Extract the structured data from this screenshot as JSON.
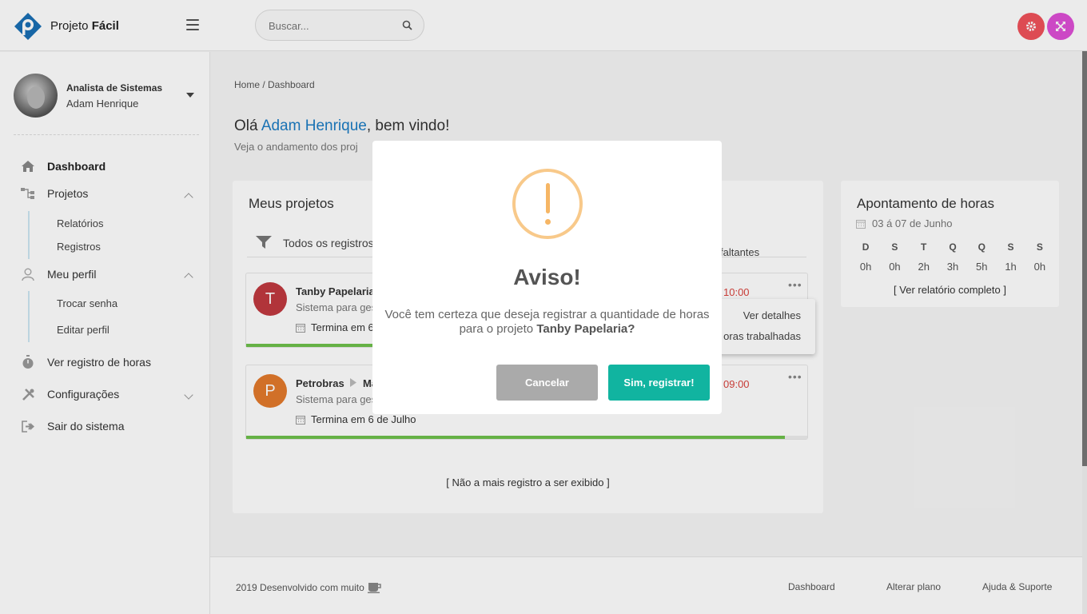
{
  "header": {
    "brand_prefix": "Projeto",
    "brand_bold": "Fácil",
    "search_placeholder": "Buscar..."
  },
  "colors": {
    "accent": "#1c7cc4",
    "settings_button": "#f0525b",
    "expand_button": "#de4fd6",
    "progress": "#6ec14b",
    "confirm_button": "#11b4a0",
    "cancel_button": "#aaaaaa",
    "warning": "#f6b665",
    "late_time": "#d9433d"
  },
  "user": {
    "role": "Analista de Sistemas",
    "name": "Adam Henrique"
  },
  "sidebar": {
    "dashboard": "Dashboard",
    "projetos": "Projetos",
    "relatorios": "Relatórios",
    "registros": "Registros",
    "meu_perfil": "Meu perfil",
    "trocar_senha": "Trocar senha",
    "editar_perfil": "Editar perfil",
    "ver_registro": "Ver registro de horas",
    "configuracoes": "Configurações",
    "sair": "Sair do sistema"
  },
  "main": {
    "breadcrumb": "Home / Dashboard",
    "greeting_prefix": "Olá ",
    "greeting_name": "Adam Henrique",
    "greeting_suffix": ", bem vindo!",
    "subtitle": "Veja o andamento dos proj"
  },
  "projects": {
    "title": "Meus projetos",
    "filter_label": "Todos os registros",
    "filter_right": "faltantes",
    "items": [
      {
        "initial": "T",
        "name": "Tanby Papelaria",
        "description": "Sistema para ges",
        "end": "Termina em 6",
        "time": "10:00",
        "progress": 0.23
      },
      {
        "initial": "P",
        "name": "Petrobras",
        "name_extra": "Ma",
        "description": "Sistema para ges",
        "end": "Termina em 6 de Julho",
        "time": "09:00",
        "progress": 0.96
      }
    ],
    "no_more": "[ Não a mais registro a ser exibido ]",
    "menu": {
      "details": "Ver detalhes",
      "hours": "oras trabalhadas"
    }
  },
  "hours": {
    "title": "Apontamento de horas",
    "range": "03  á 07 de Junho",
    "days": [
      {
        "d": "D",
        "h": "0h"
      },
      {
        "d": "S",
        "h": "0h"
      },
      {
        "d": "T",
        "h": "2h"
      },
      {
        "d": "Q",
        "h": "3h"
      },
      {
        "d": "Q",
        "h": "5h"
      },
      {
        "d": "S",
        "h": "1h"
      },
      {
        "d": "S",
        "h": "0h"
      }
    ],
    "link": "[ Ver relatório completo ]"
  },
  "footer": {
    "credit": "2019 Desenvolvido com muito",
    "links": [
      "Dashboard",
      "Alterar plano",
      "Ajuda & Suporte"
    ]
  },
  "modal": {
    "title": "Aviso!",
    "text_before": "Você tem certeza que deseja registrar a quantidade de horas para o projeto ",
    "project": "Tanby Papelaria",
    "text_after": "?",
    "cancel": "Cancelar",
    "confirm": "Sim, registrar!"
  }
}
